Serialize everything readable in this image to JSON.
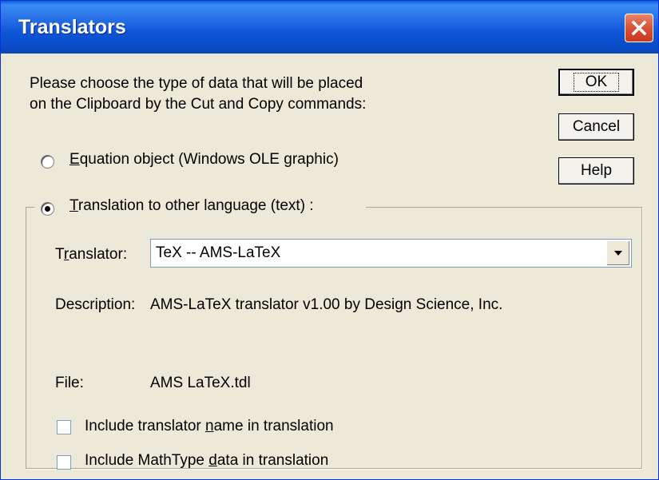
{
  "window": {
    "title": "Translators"
  },
  "intro": {
    "line1": "Please choose the type of data that will be placed",
    "line2": "on the Clipboard by the Cut and Copy commands:"
  },
  "buttons": {
    "ok": "OK",
    "cancel": "Cancel",
    "help": "Help"
  },
  "options": {
    "equation": {
      "accel": "E",
      "rest": "quation object (Windows OLE graphic)",
      "selected": false
    },
    "translation": {
      "accel": "T",
      "rest": "ranslation to other language (text) :",
      "selected": true
    }
  },
  "translator": {
    "label_pre": "T",
    "label_accel": "r",
    "label_post": "anslator:",
    "value": "TeX -- AMS-LaTeX"
  },
  "description": {
    "label": "Description:",
    "value": "AMS-LaTeX translator v1.00 by Design Science, Inc."
  },
  "file": {
    "label": "File:",
    "value": "AMS LaTeX.tdl"
  },
  "checks": {
    "name": {
      "pre": "Include translator ",
      "accel": "n",
      "post": "ame in translation",
      "checked": false
    },
    "mathtype": {
      "pre": "Include MathType ",
      "accel": "d",
      "post": "ata in translation",
      "checked": false
    }
  }
}
